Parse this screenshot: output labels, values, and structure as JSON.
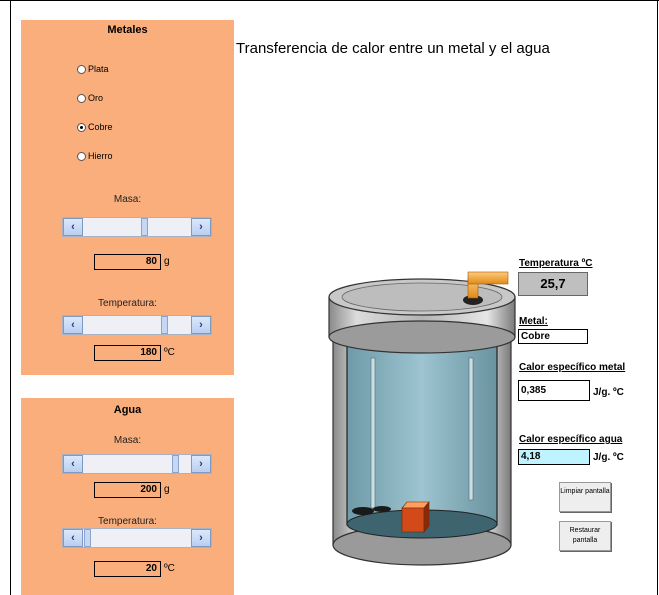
{
  "title": "Transferencia de calor entre un metal y el agua",
  "metales": {
    "title": "Metales",
    "options": [
      {
        "label": "Plata",
        "selected": false
      },
      {
        "label": "Oro",
        "selected": false
      },
      {
        "label": "Cobre",
        "selected": true
      },
      {
        "label": "Hierro",
        "selected": false
      }
    ],
    "masa_label": "Masa:",
    "masa_value": "80",
    "masa_unit": "g",
    "temp_label": "Temperatura:",
    "temp_value": "180",
    "temp_unit": "ºC"
  },
  "agua": {
    "title": "Agua",
    "masa_label": "Masa:",
    "masa_value": "200",
    "masa_unit": "g",
    "temp_label": "Temperatura:",
    "temp_value": "20",
    "temp_unit": "ºC"
  },
  "readouts": {
    "temperatura_label": "Temperatura ºC",
    "temperatura_value": "25,7",
    "metal_label": "Metal:",
    "metal_value": "Cobre",
    "calor_metal_label": "Calor específico metal",
    "calor_metal_value": "0,385",
    "calor_metal_unit": "J/g. ºC",
    "calor_agua_label": "Calor específico agua",
    "calor_agua_value": "4,18",
    "calor_agua_unit": "J/g. ºC"
  },
  "buttons": {
    "limpiar": "Limpiar pantalla",
    "restaurar": "Restaurar pantalla"
  },
  "colors": {
    "panel": "#f9ae7c",
    "water": "#8fb8c4",
    "calor_agua_field": "#bff3ff"
  }
}
